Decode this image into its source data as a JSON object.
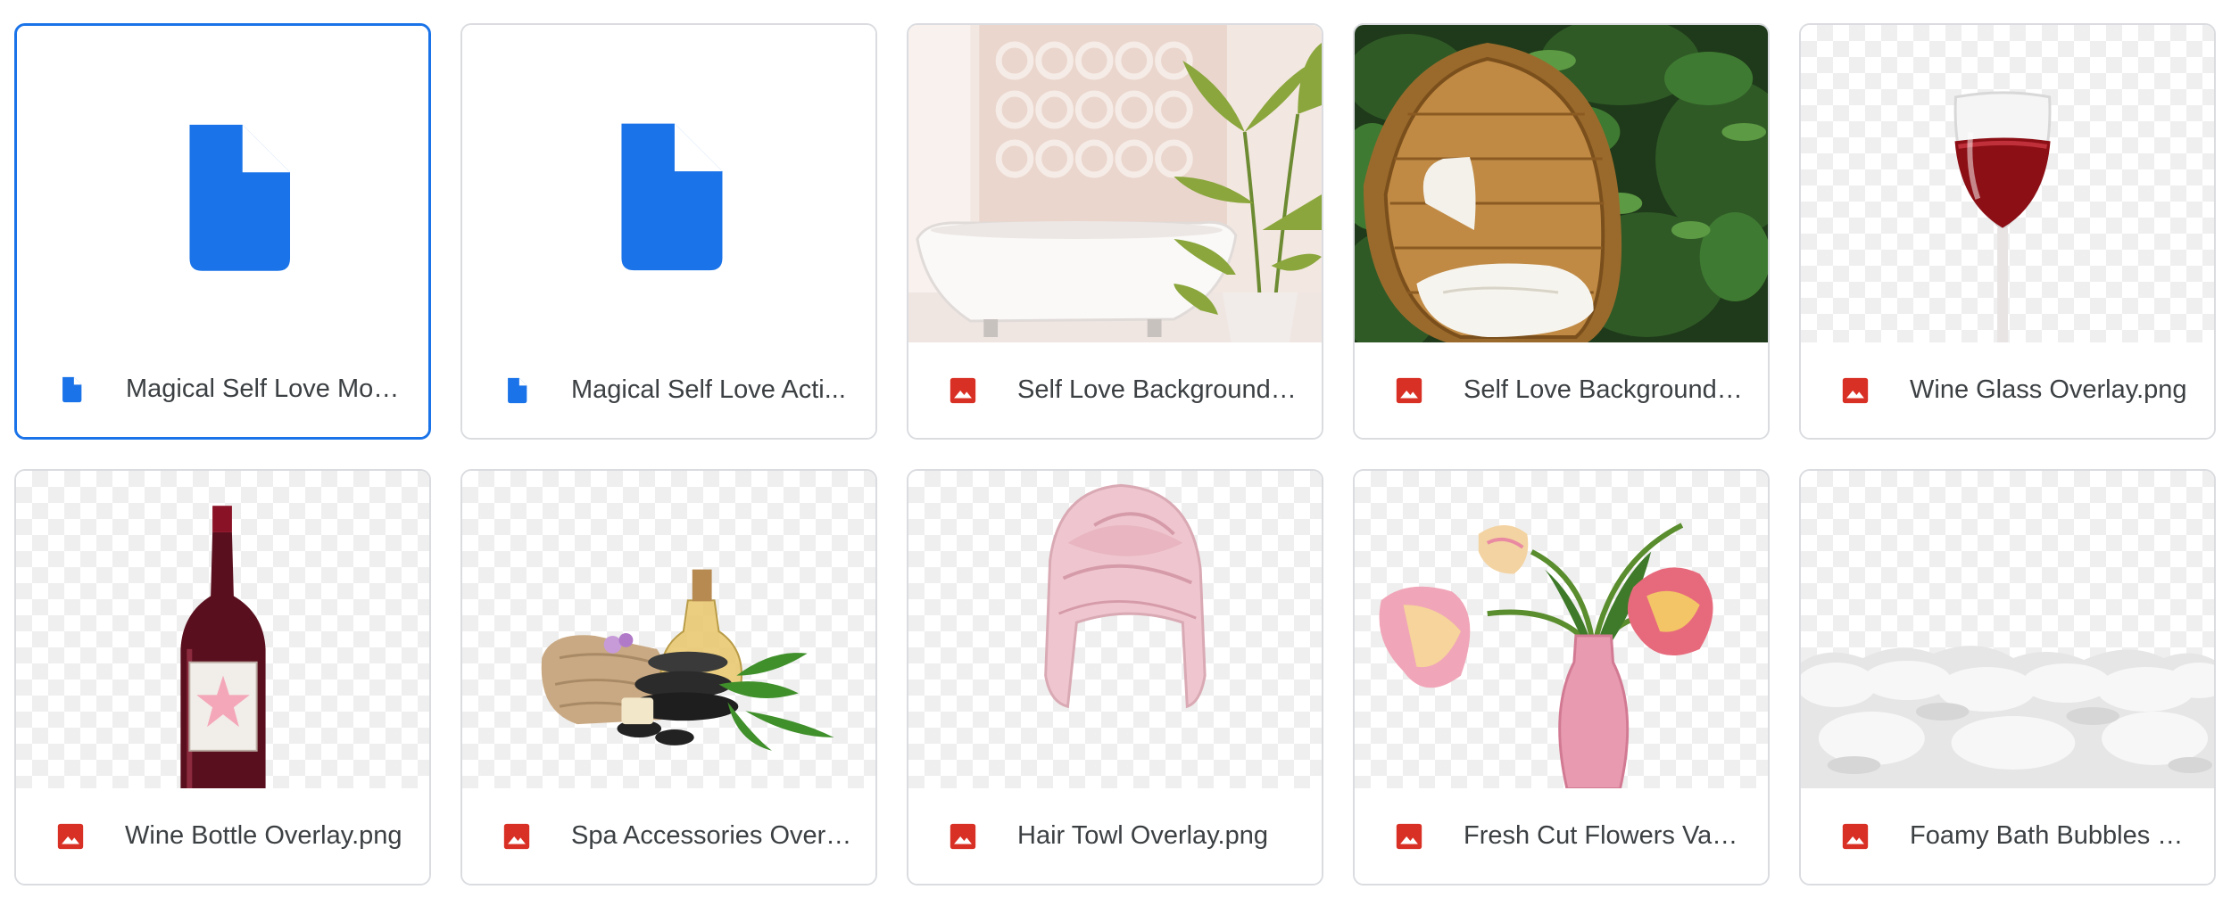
{
  "files": [
    {
      "name": "Magical Self Love Mon...",
      "type": "doc",
      "icon": "doc-file-icon",
      "preview": "doc-large-icon",
      "selected": true
    },
    {
      "name": "Magical Self Love Acti...",
      "type": "doc",
      "icon": "doc-file-icon",
      "preview": "doc-large-icon",
      "selected": false
    },
    {
      "name": "Self Love Background ...",
      "type": "image",
      "icon": "image-file-icon",
      "preview": "bathtub-photo",
      "selected": false
    },
    {
      "name": "Self Love Background ...",
      "type": "image",
      "icon": "image-file-icon",
      "preview": "hanging-chair-photo",
      "selected": false
    },
    {
      "name": "Wine Glass Overlay.png",
      "type": "image",
      "icon": "image-file-icon",
      "preview": "wine-glass-image",
      "selected": false
    },
    {
      "name": "Wine Bottle Overlay.png",
      "type": "image",
      "icon": "image-file-icon",
      "preview": "wine-bottle-image",
      "selected": false
    },
    {
      "name": "Spa Accessories Overl...",
      "type": "image",
      "icon": "image-file-icon",
      "preview": "spa-accessories-image",
      "selected": false
    },
    {
      "name": "Hair Towl Overlay.png",
      "type": "image",
      "icon": "image-file-icon",
      "preview": "hair-towel-image",
      "selected": false
    },
    {
      "name": "Fresh Cut Flowers Vas...",
      "type": "image",
      "icon": "image-file-icon",
      "preview": "tulip-vase-image",
      "selected": false
    },
    {
      "name": "Foamy Bath Bubbles O...",
      "type": "image",
      "icon": "image-file-icon",
      "preview": "bath-foam-image",
      "selected": false
    }
  ],
  "colors": {
    "doc_blue": "#1a73e8",
    "image_red": "#d93025",
    "selected_border": "#1a73e8",
    "card_border": "#dadce0",
    "text": "#3c4043"
  }
}
